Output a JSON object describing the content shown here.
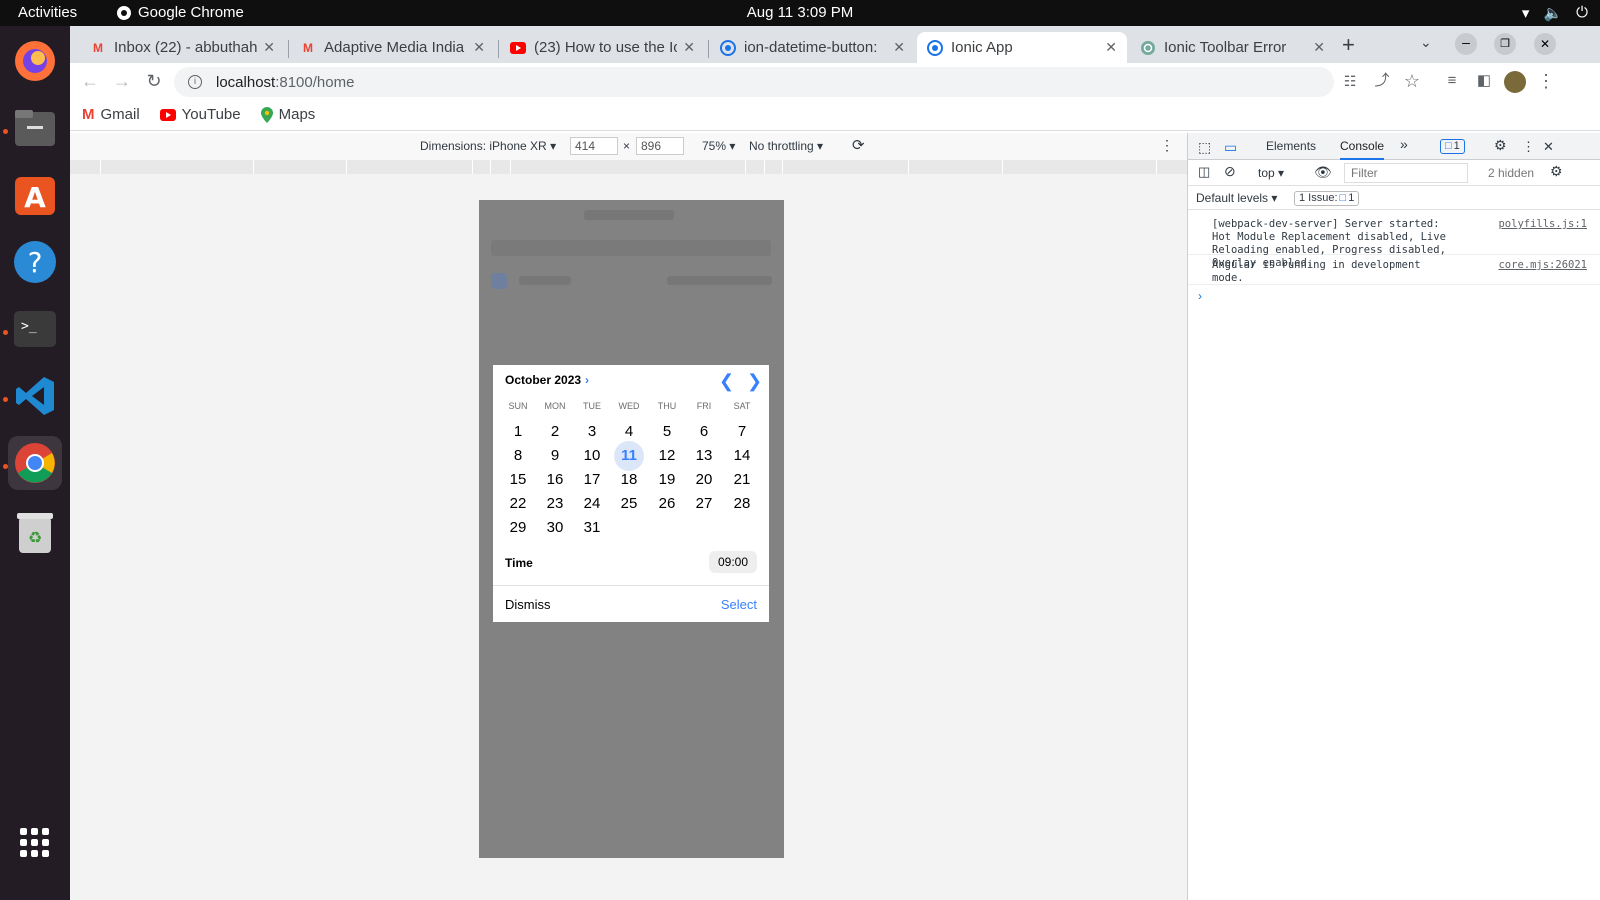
{
  "system": {
    "activities": "Activities",
    "app_name": "Google Chrome",
    "clock": "Aug 11  3:09 PM"
  },
  "tabs": [
    {
      "title": "Inbox (22) - abbuthah",
      "icon": "gmail-icon"
    },
    {
      "title": "Adaptive Media India",
      "icon": "gmail-icon"
    },
    {
      "title": "(23) How to use the Io",
      "icon": "youtube-icon"
    },
    {
      "title": "ion-datetime-button:",
      "icon": "chrome-icon"
    },
    {
      "title": "Ionic App",
      "icon": "chrome-icon",
      "active": true
    },
    {
      "title": "Ionic Toolbar Error",
      "icon": "openai-icon"
    }
  ],
  "address": {
    "host": "localhost",
    "path": ":8100/home"
  },
  "bookmarks": [
    {
      "label": "Gmail",
      "icon": "gmail-icon"
    },
    {
      "label": "YouTube",
      "icon": "youtube-icon"
    },
    {
      "label": "Maps",
      "icon": "maps-icon"
    }
  ],
  "device_toolbar": {
    "dimensions": "Dimensions: iPhone XR",
    "width": "414",
    "height": "896",
    "times": "×",
    "zoom": "75%",
    "throttling": "No throttling"
  },
  "datetime": {
    "month_label": "October 2023",
    "weekdays": [
      "SUN",
      "MON",
      "TUE",
      "WED",
      "THU",
      "FRI",
      "SAT"
    ],
    "first_weekday_index": 0,
    "days_in_month": 31,
    "today": 11,
    "time_label": "Time",
    "time_value": "09:00",
    "dismiss": "Dismiss",
    "select": "Select"
  },
  "devtools": {
    "tabs": [
      "Elements",
      "Console"
    ],
    "selected_tab": "Console",
    "issues_badge": "1",
    "context": "top",
    "filter_placeholder": "Filter",
    "hidden": "2 hidden",
    "levels": "Default levels",
    "issues_label": "1 Issue:",
    "issues_count": "1",
    "messages": [
      {
        "text": "[webpack-dev-server] Server started: Hot Module Replacement disabled, Live Reloading enabled, Progress disabled, Overlay enabled.",
        "source": "polyfills.js:1"
      },
      {
        "text": "Angular is running in development mode.",
        "source": "core.mjs:26021"
      }
    ]
  },
  "colors": {
    "ionic_primary": "#3880ff",
    "today_bg": "#dbe6f9"
  }
}
